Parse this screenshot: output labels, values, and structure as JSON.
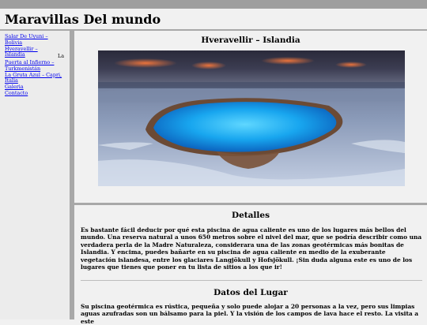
{
  "site": {
    "title": "Maravillas Del mundo"
  },
  "nav": {
    "items": [
      {
        "label": "Salar De Uyuni – Bolivia"
      },
      {
        "label": "Hveravellir – Islandia"
      },
      {
        "label": "Puerta al Infierno – Turkmenistán"
      },
      {
        "label": "La Gruta Azul – Capri, Italia"
      },
      {
        "label": "Galeria"
      },
      {
        "label": "Contacto"
      }
    ],
    "stray_text": "La"
  },
  "main": {
    "title": "Hveravellir – Islandia",
    "photo_alt": "Piscina geotérmica azul de Hveravellir",
    "details": {
      "title": "Detalles",
      "text": "Es bastante fácil deducir por qué esta piscina de agua caliente es uno de los lugares más bellos del mundo. Una reserva natural a unos 650 metros sobre el nivel del mar, que se podría describir como una verdadera perla de la Madre Naturaleza, considerara una de las zonas geotérmicas más bonitas de Islandia. Y encima, puedes bañarte en su piscina de agua caliente en medio de la exuberante vegetación islandesa, entre los glaciares Langjökull y Hofsjökull. ¡Sin duda alguna este es uno de los lugares que tienes que poner en tu lista de sitios a los que ir!"
    },
    "datos": {
      "title": "Datos del Lugar",
      "text": "Su piscina geotérmica es rústica, pequeña y solo puede alojar a 20 personas a la vez, pero sus limpias aguas azufradas son un bálsamo para la piel. Y la visión de los campos de lava hace el resto. La visita a este"
    }
  }
}
